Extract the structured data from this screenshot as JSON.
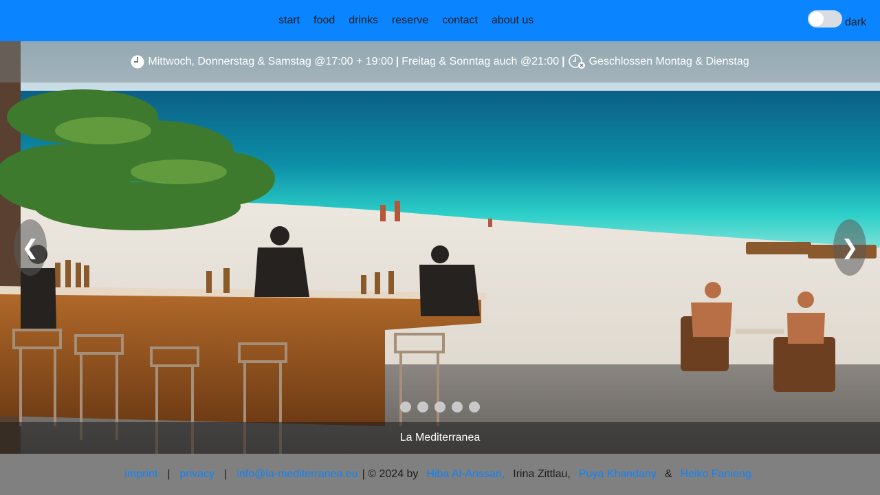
{
  "nav": {
    "links": [
      "start",
      "food",
      "drinks",
      "reserve",
      "contact",
      "about us"
    ],
    "theme_label": "dark"
  },
  "hero": {
    "hours_part1": "Mittwoch, Donnerstag & Samstag @17:00 + 19:00",
    "hours_part2": "Freitag & Sonntag auch @21:00",
    "closed": "Geschlossen Montag & Dienstag",
    "separator": "|",
    "prev": "❮",
    "next": "❯",
    "caption": "La Mediterranea",
    "slide_count": 5
  },
  "footer": {
    "imprint": "imprint",
    "privacy": "privacy",
    "email": "info@la-mediterranea.eu",
    "pipe": "|",
    "copyright": "| © 2024 by",
    "author1": "Hiba Al-Anssari,",
    "author2": "Irina Zittlau,",
    "author3": "Puya Khandany",
    "amp": "&",
    "author4": "Heiko Fanieng"
  },
  "colors": {
    "nav_bg": "#0a84ff",
    "link": "#0a84ff",
    "footer_bg": "#808080"
  }
}
